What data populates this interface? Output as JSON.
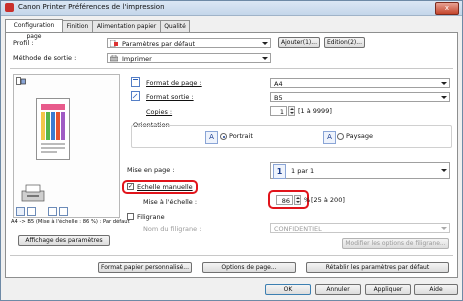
{
  "window": {
    "title": "Canon Printer Préférences de l'impression",
    "close_label": "x"
  },
  "tabs": [
    {
      "label": "Configuration page"
    },
    {
      "label": "Finition"
    },
    {
      "label": "Alimentation papier"
    },
    {
      "label": "Qualité"
    }
  ],
  "profile": {
    "label": "Profil :",
    "value": "Paramètres par défaut",
    "add_label": "Ajouter(1)...",
    "edit_label": "Edition(2)..."
  },
  "output_method": {
    "label": "Méthode de sortie :",
    "value": "Imprimer"
  },
  "preview": {
    "caption": "A4 -> B5 (Mise à l'échelle : 86 %) : Par défaut"
  },
  "show_settings_label": "Affichage des paramètres",
  "page_size": {
    "label": "Format de page :",
    "value": "A4"
  },
  "output_size": {
    "label": "Format sortie :",
    "value": "B5"
  },
  "copies": {
    "label": "Copies :",
    "value": "1",
    "range": "[1 à 9999]"
  },
  "orientation": {
    "label": "Orientation",
    "portrait": "Portrait",
    "landscape": "Paysage",
    "selected": "portrait"
  },
  "layout": {
    "label": "Mise en page :",
    "value": "1 par 1",
    "icon_number": "1"
  },
  "manual_scaling": {
    "label": "Echelle manuelle",
    "checked": true
  },
  "scaling": {
    "label": "Mise à l'échelle :",
    "value": "86",
    "unit": "%",
    "range": "[25 à 200]"
  },
  "watermark": {
    "label": "Filigrane",
    "checked": false,
    "name_label": "Nom du filigrane :",
    "name_value": "CONFIDENTIEL",
    "modify_label": "Modifier les options de filigrane..."
  },
  "footer": {
    "custom_paper": "Format papier personnalisé...",
    "page_options": "Options de page...",
    "restore_defaults": "Rétablir les paramètres par défaut",
    "ok": "OK",
    "cancel": "Annuler",
    "apply": "Appliquer",
    "help": "Aide"
  },
  "colors": {
    "accent": "#1a3d8f",
    "highlight": "#e1141b"
  }
}
